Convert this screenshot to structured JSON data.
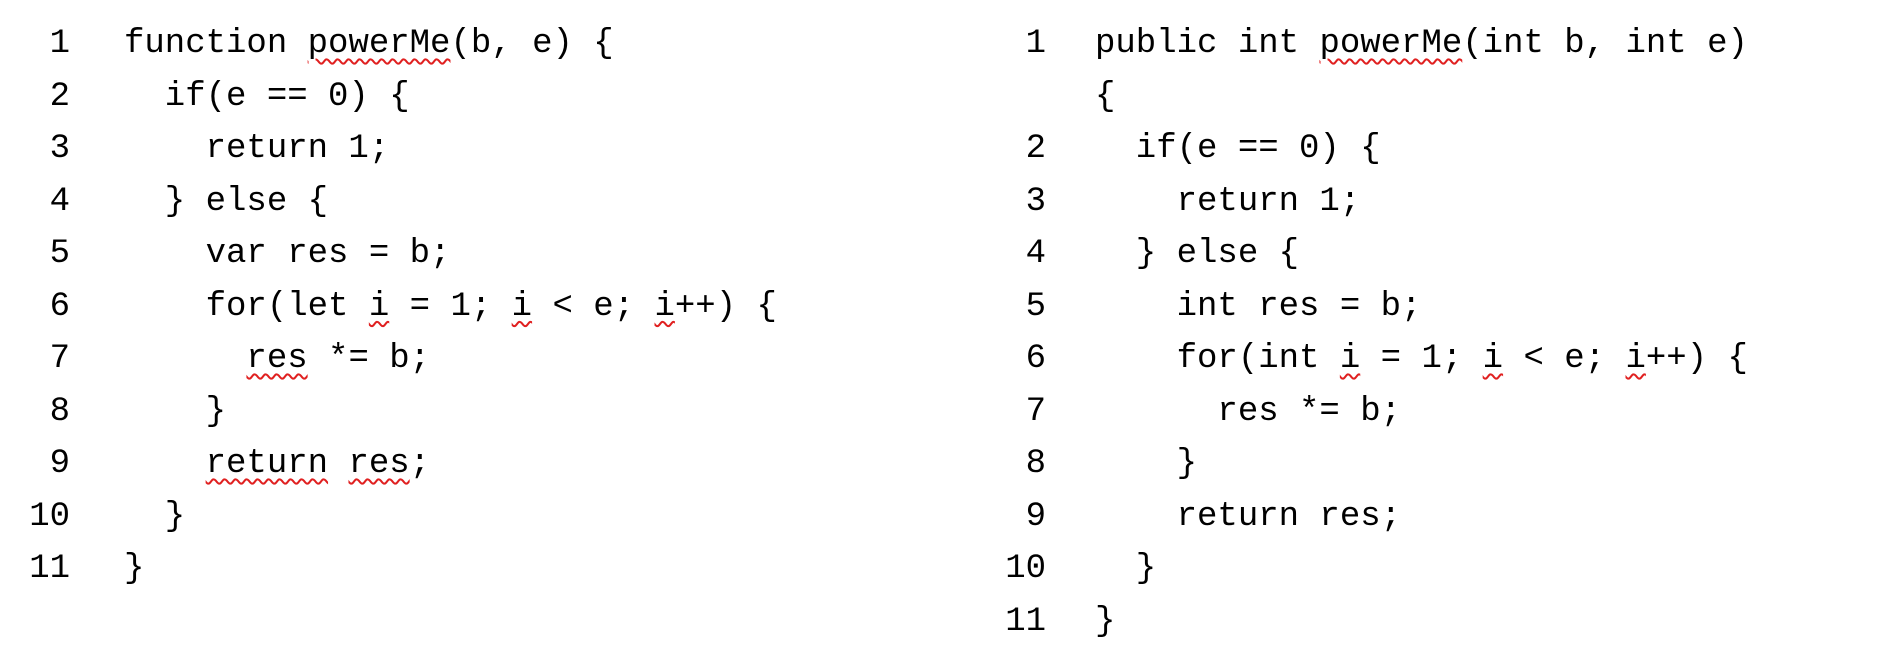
{
  "left_code": {
    "lines": [
      {
        "num": "1",
        "segments": [
          {
            "text": "function "
          },
          {
            "text": "powerMe",
            "err": true
          },
          {
            "text": "(b, e) {"
          }
        ]
      },
      {
        "num": "2",
        "segments": [
          {
            "text": "  if(e == 0) {"
          }
        ]
      },
      {
        "num": "3",
        "segments": [
          {
            "text": "    return 1;"
          }
        ]
      },
      {
        "num": "4",
        "segments": [
          {
            "text": "  } else {"
          }
        ]
      },
      {
        "num": "5",
        "segments": [
          {
            "text": "    var res = b;"
          }
        ]
      },
      {
        "num": "6",
        "segments": [
          {
            "text": "    for(let "
          },
          {
            "text": "i",
            "err": true
          },
          {
            "text": " = 1; "
          },
          {
            "text": "i",
            "err": true
          },
          {
            "text": " < e; "
          },
          {
            "text": "i",
            "err": true
          },
          {
            "text": "++) {"
          }
        ]
      },
      {
        "num": "7",
        "segments": [
          {
            "text": "      "
          },
          {
            "text": "res",
            "err": true
          },
          {
            "text": " *= b;"
          }
        ]
      },
      {
        "num": "8",
        "segments": [
          {
            "text": "    }"
          }
        ]
      },
      {
        "num": "9",
        "segments": [
          {
            "text": "    "
          },
          {
            "text": "return",
            "err": true
          },
          {
            "text": " "
          },
          {
            "text": "res",
            "err": true
          },
          {
            "text": ";"
          }
        ]
      },
      {
        "num": "10",
        "segments": [
          {
            "text": "  }"
          }
        ]
      },
      {
        "num": "11",
        "segments": [
          {
            "text": "}"
          }
        ]
      }
    ]
  },
  "right_code": {
    "lines": [
      {
        "num": "1",
        "segments": [
          {
            "text": "public int "
          },
          {
            "text": "powerMe",
            "err": true
          },
          {
            "text": "(int b, int e)"
          }
        ]
      },
      {
        "num": "",
        "segments": [
          {
            "text": "{"
          }
        ]
      },
      {
        "num": "2",
        "segments": [
          {
            "text": "  if(e == 0) {"
          }
        ]
      },
      {
        "num": "3",
        "segments": [
          {
            "text": "    return 1;"
          }
        ]
      },
      {
        "num": "4",
        "segments": [
          {
            "text": "  } else {"
          }
        ]
      },
      {
        "num": "5",
        "segments": [
          {
            "text": "    int res = b;"
          }
        ]
      },
      {
        "num": "6",
        "segments": [
          {
            "text": "    for(int "
          },
          {
            "text": "i",
            "err": true
          },
          {
            "text": " = 1; "
          },
          {
            "text": "i",
            "err": true
          },
          {
            "text": " < e; "
          },
          {
            "text": "i",
            "err": true
          },
          {
            "text": "++) {"
          }
        ]
      },
      {
        "num": "7",
        "segments": [
          {
            "text": "      res *= b;"
          }
        ]
      },
      {
        "num": "8",
        "segments": [
          {
            "text": "    }"
          }
        ]
      },
      {
        "num": "9",
        "segments": [
          {
            "text": "    return res;"
          }
        ]
      },
      {
        "num": "10",
        "segments": [
          {
            "text": "  }"
          }
        ]
      },
      {
        "num": "11",
        "segments": [
          {
            "text": "}"
          }
        ]
      }
    ]
  }
}
